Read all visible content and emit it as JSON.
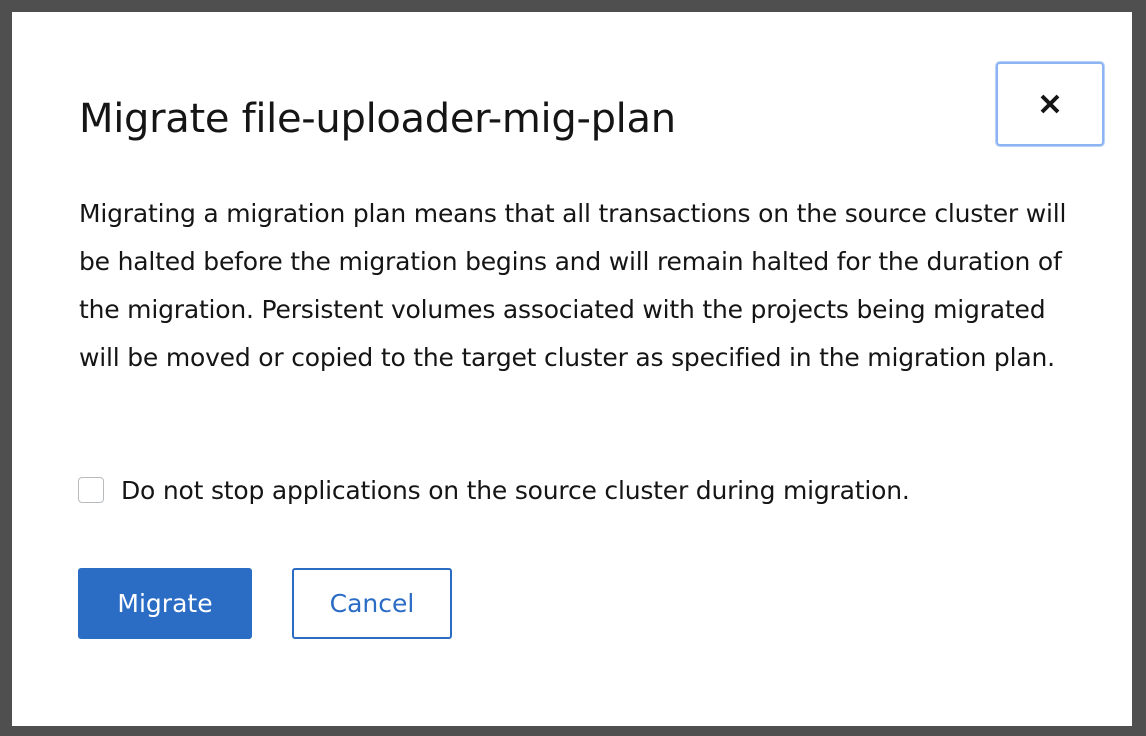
{
  "modal": {
    "title": "Migrate file-uploader-mig-plan",
    "close_icon": "close-icon",
    "body": "Migrating a migration plan means that all transactions on the source cluster will be halted before the migration begins and will remain halted for the duration of the migration. Persistent volumes associated with the projects being migrated will be moved or copied to the target cluster as specified in the migration plan.",
    "checkbox": {
      "label": "Do not stop applications on the source cluster during migration.",
      "checked": false
    },
    "buttons": {
      "migrate_label": "Migrate",
      "cancel_label": "Cancel"
    }
  },
  "colors": {
    "primary": "#2b6cc4",
    "focus_ring": "#8cb4f2",
    "text": "#151515",
    "backdrop": "#4f4f4f"
  }
}
